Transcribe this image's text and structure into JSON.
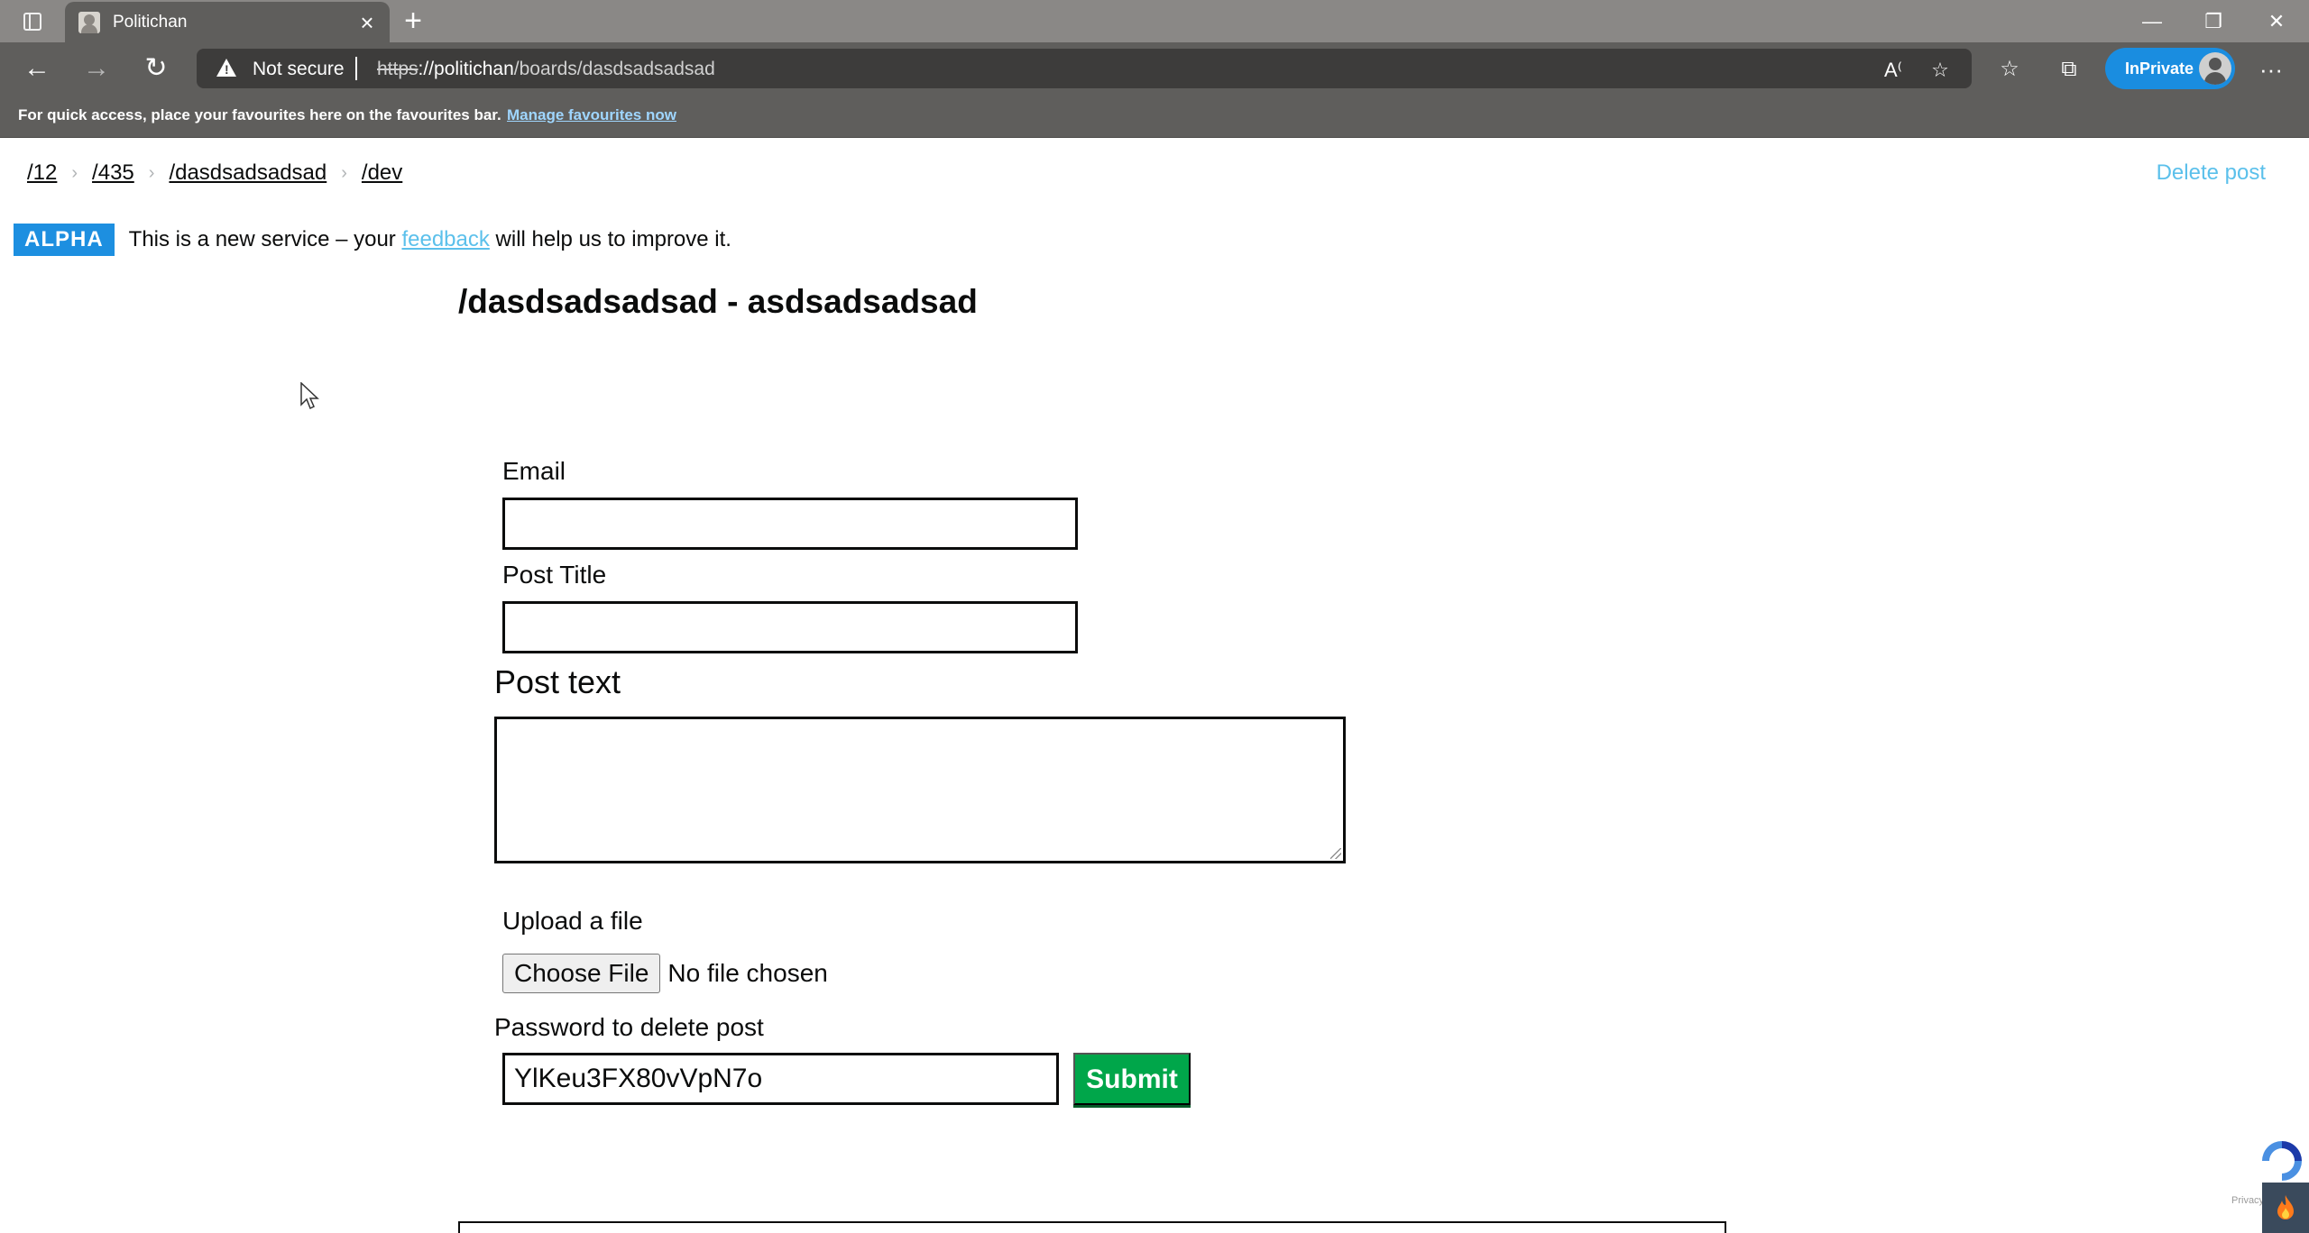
{
  "browser": {
    "tab_title": "Politichan",
    "security_label": "Not secure",
    "url_scheme": "https",
    "url_host": "://politichan",
    "url_path": "/boards/dasdsadsadsad",
    "inprivate_label": "InPrivate",
    "favbar_text": "For quick access, place your favourites here on the favourites bar.",
    "favbar_link": "Manage favourites now"
  },
  "breadcrumb": [
    {
      "label": "/12"
    },
    {
      "label": "/435"
    },
    {
      "label": "/dasdsadsadsad"
    },
    {
      "label": "/dev"
    }
  ],
  "header": {
    "delete_post": "Delete post"
  },
  "banner": {
    "tag": "ALPHA",
    "text_before": "This is a new service – your ",
    "link": "feedback",
    "text_after": " will help us to improve it."
  },
  "board": {
    "title": "/dasdsadsadsad - asdsadsadsad"
  },
  "form": {
    "email_label": "Email",
    "email_value": "",
    "title_label": "Post Title",
    "title_value": "",
    "text_label": "Post text",
    "text_value": "",
    "upload_label": "Upload a file",
    "choose_file": "Choose File",
    "file_status": "No file chosen",
    "password_label": "Password to delete post",
    "password_value": "YlKeu3FX80vVpN7o",
    "submit": "Submit"
  },
  "footer": {
    "recaptcha_text": "Privacy"
  },
  "colors": {
    "accent_link": "#5bc0eb",
    "alpha_tag": "#1d8fe0",
    "submit_green": "#00a64a",
    "chrome_dark": "#5f5e5c"
  }
}
